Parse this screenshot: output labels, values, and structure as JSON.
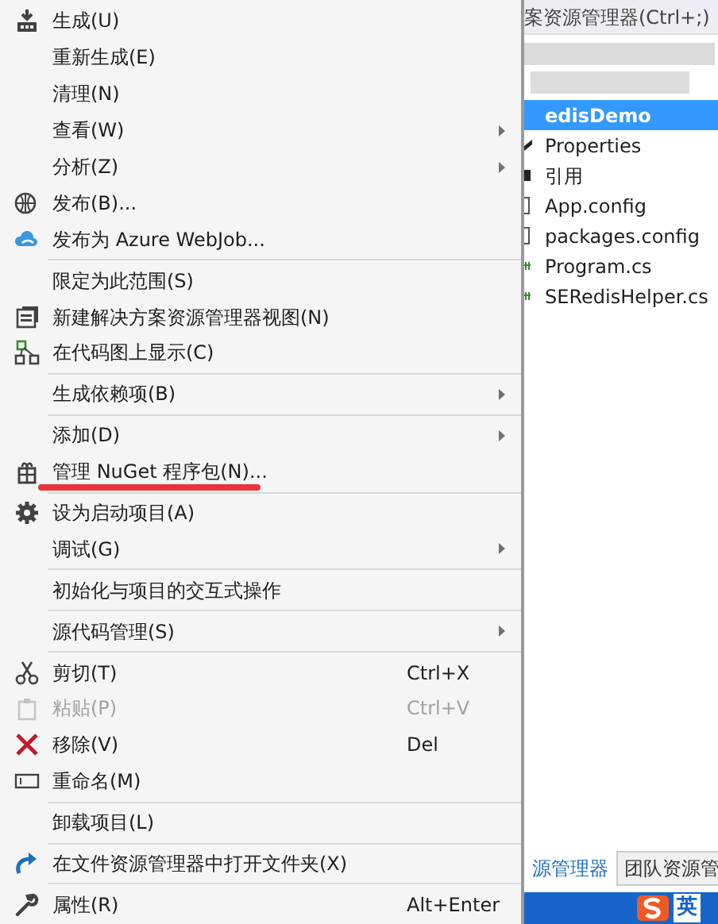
{
  "menu": {
    "items": [
      {
        "kind": "item",
        "label": "生成(U)"
      },
      {
        "kind": "item",
        "label": "重新生成(E)"
      },
      {
        "kind": "item",
        "label": "清理(N)"
      },
      {
        "kind": "item",
        "label": "查看(W)",
        "submenu": true
      },
      {
        "kind": "item",
        "label": "分析(Z)",
        "submenu": true
      },
      {
        "kind": "item",
        "label": "发布(B)..."
      },
      {
        "kind": "item",
        "label": "发布为 Azure WebJob..."
      },
      {
        "kind": "separator"
      },
      {
        "kind": "item",
        "label": "限定为此范围(S)"
      },
      {
        "kind": "item",
        "label": "新建解决方案资源管理器视图(N)"
      },
      {
        "kind": "item",
        "label": "在代码图上显示(C)"
      },
      {
        "kind": "separator"
      },
      {
        "kind": "item",
        "label": "生成依赖项(B)",
        "submenu": true
      },
      {
        "kind": "separator"
      },
      {
        "kind": "item",
        "label": "添加(D)",
        "submenu": true
      },
      {
        "kind": "item",
        "label": "管理 NuGet 程序包(N)...",
        "underlined": true
      },
      {
        "kind": "separator"
      },
      {
        "kind": "item",
        "label": "设为启动项目(A)"
      },
      {
        "kind": "item",
        "label": "调试(G)",
        "submenu": true
      },
      {
        "kind": "separator"
      },
      {
        "kind": "item",
        "label": "初始化与项目的交互式操作"
      },
      {
        "kind": "separator"
      },
      {
        "kind": "item",
        "label": "源代码管理(S)",
        "submenu": true
      },
      {
        "kind": "separator"
      },
      {
        "kind": "item",
        "label": "剪切(T)",
        "shortcut": "Ctrl+X"
      },
      {
        "kind": "item",
        "label": "粘贴(P)",
        "shortcut": "Ctrl+V",
        "disabled": true
      },
      {
        "kind": "item",
        "label": "移除(V)",
        "shortcut": "Del"
      },
      {
        "kind": "item",
        "label": "重命名(M)"
      },
      {
        "kind": "separator"
      },
      {
        "kind": "item",
        "label": "卸载项目(L)"
      },
      {
        "kind": "separator"
      },
      {
        "kind": "item",
        "label": "在文件资源管理器中打开文件夹(X)"
      },
      {
        "kind": "separator"
      },
      {
        "kind": "item",
        "label": "属性(R)",
        "shortcut": "Alt+Enter"
      }
    ]
  },
  "explorer": {
    "title": "案资源管理器(Ctrl+;)",
    "tree": [
      {
        "label": "edisDemo",
        "selected": true
      },
      {
        "label": "Properties",
        "selected": false
      },
      {
        "label": "引用",
        "selected": false
      },
      {
        "label": "App.config",
        "selected": false
      },
      {
        "label": "packages.config",
        "selected": false
      },
      {
        "label": "Program.cs",
        "selected": false
      },
      {
        "label": "SERedisHelper.cs",
        "selected": false
      }
    ],
    "tabs": [
      {
        "label": "源管理器",
        "selected": true
      },
      {
        "label": "团队资源管",
        "selected": false
      }
    ]
  },
  "taskbar": {
    "ime_mode": "英"
  }
}
